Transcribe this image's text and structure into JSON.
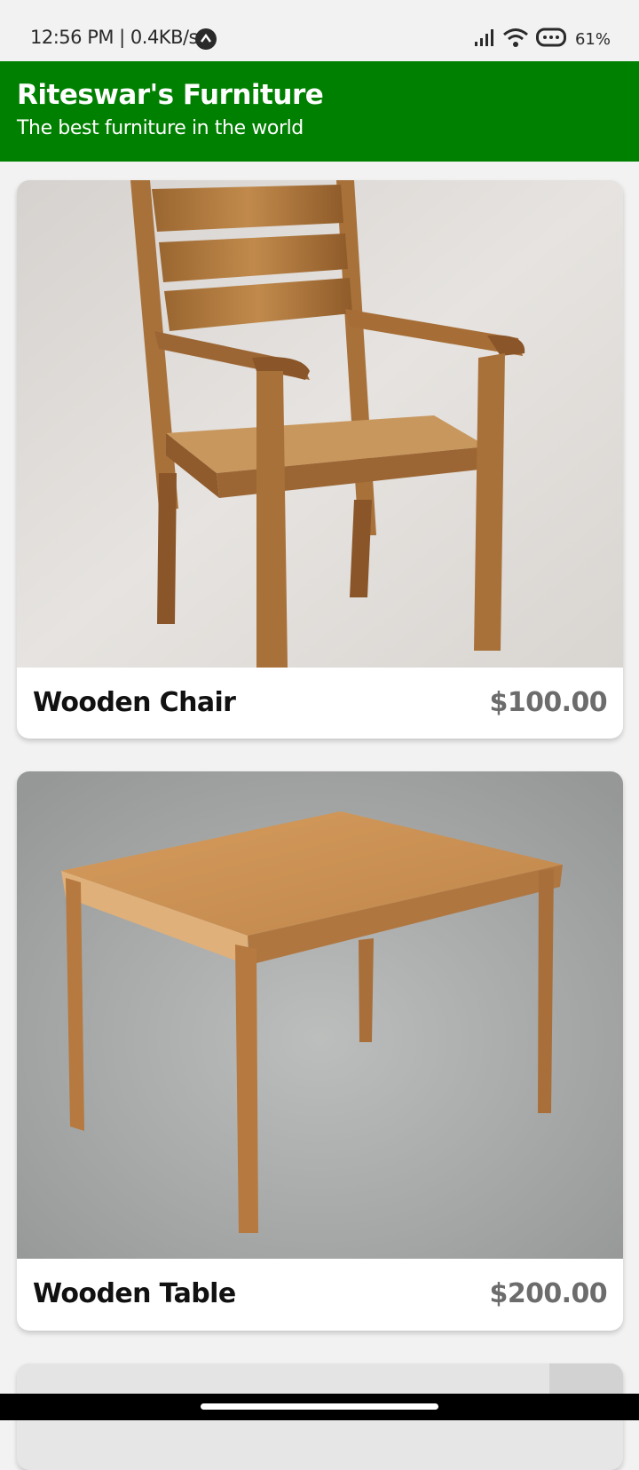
{
  "status_bar": {
    "time_speed": "12:56 PM | 0.4KB/s",
    "battery": "61%"
  },
  "header": {
    "title": "Riteswar's Furniture",
    "subtitle": "The best furniture in the world",
    "color": "#008000"
  },
  "products": [
    {
      "name": "Wooden Chair",
      "price": "$100.00",
      "icon": "wooden-chair-photo"
    },
    {
      "name": "Wooden Table",
      "price": "$200.00",
      "icon": "wooden-table-photo"
    }
  ]
}
